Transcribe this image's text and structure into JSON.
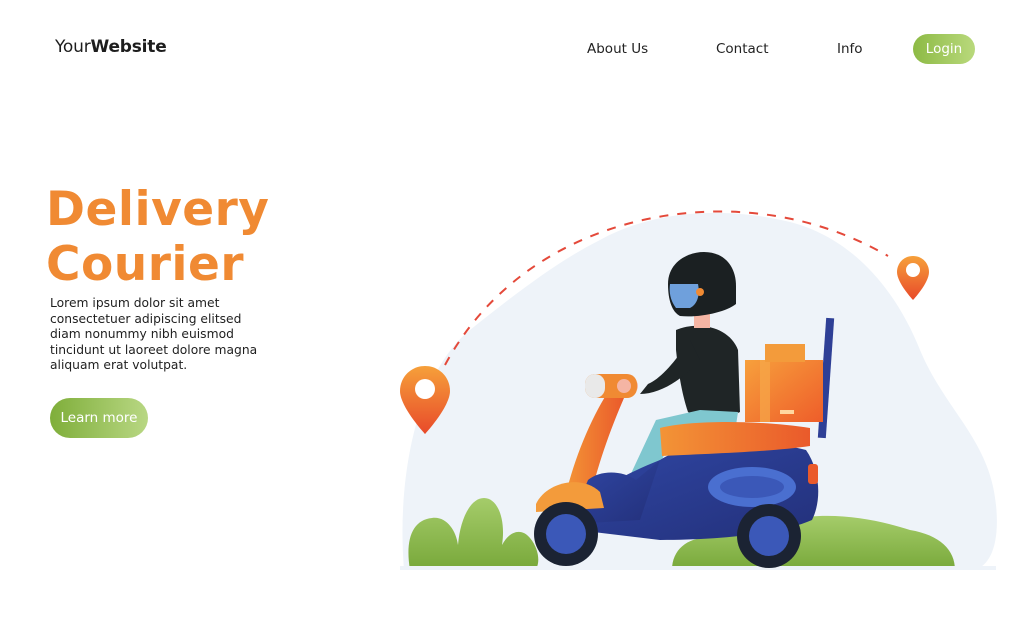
{
  "header": {
    "logo_prefix": "Your",
    "logo_bold": "Website",
    "nav": [
      "About Us",
      "Contact",
      "Info"
    ],
    "login_label": "Login"
  },
  "hero": {
    "title_line1": "Delivery",
    "title_line2": "Courier",
    "body_lines": [
      "Lorem ipsum dolor sit amet",
      "consectetuer adipiscing elitsed",
      "diam nonummy nibh euismod",
      "tincidunt ut laoreet dolore magna",
      "aliquam erat volutpat."
    ],
    "cta_label": "Learn more"
  },
  "illustration": {
    "subject": "courier-on-scooter",
    "icons": [
      "map-pin-icon",
      "map-pin-icon"
    ],
    "colors": {
      "accent_orange": "#f08a33",
      "green": "#8dba45",
      "scooter_blue": "#2f3f8f",
      "blob": "#eef3f9",
      "route": "#e4493a"
    }
  }
}
